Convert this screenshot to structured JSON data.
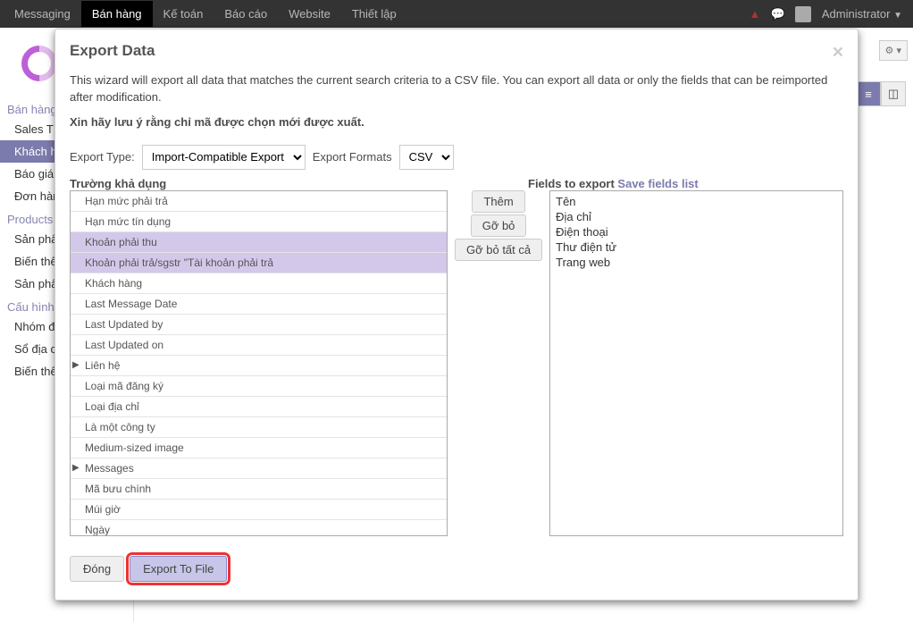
{
  "topbar": {
    "items": [
      "Messaging",
      "Bán hàng",
      "Kế toán",
      "Báo cáo",
      "Website",
      "Thiết lập"
    ],
    "active_index": 1,
    "user": "Administrator"
  },
  "sidebar": {
    "groups": [
      {
        "header": "Bán hàng",
        "items": [
          "Sales T…",
          "Khách h…",
          "Báo giá…",
          "Đơn hàng…"
        ],
        "active_index": 1
      },
      {
        "header": "Products",
        "items": [
          "Sản phẩ…",
          "Biến thể…",
          "Sản phẩ…"
        ]
      },
      {
        "header": "Cấu hình",
        "items": [
          "Nhóm đ…",
          "Sổ địa c…",
          "Biến thể…"
        ]
      }
    ]
  },
  "modal": {
    "title": "Export Data",
    "desc": "This wizard will export all data that matches the current search criteria to a CSV file. You can export all data or only the fields that can be reimported after modification.",
    "warn": "Xin hãy lưu ý rằng chỉ mã được chọn mới được xuất.",
    "export_type_label": "Export Type:",
    "export_type_value": "Import-Compatible Export",
    "export_formats_label": "Export Formats",
    "export_formats_value": "CSV",
    "left_header": "Trường khả dụng",
    "right_header": "Fields to export",
    "save_link": "Save fields list",
    "available": [
      {
        "label": "Hạn mức phải trả"
      },
      {
        "label": "Hạn mức tín dụng"
      },
      {
        "label": "Khoản phải thu",
        "selected": true
      },
      {
        "label": "Khoản phải trả/sgstr \"Tài khoản phải trả",
        "selected": true
      },
      {
        "label": "Khách hàng"
      },
      {
        "label": "Last Message Date"
      },
      {
        "label": "Last Updated by"
      },
      {
        "label": "Last Updated on"
      },
      {
        "label": "Liên hệ",
        "expandable": true
      },
      {
        "label": "Loại mã đăng ký"
      },
      {
        "label": "Loại địa chỉ"
      },
      {
        "label": "Là một công ty"
      },
      {
        "label": "Medium-sized image"
      },
      {
        "label": "Messages",
        "expandable": true
      },
      {
        "label": "Mã bưu chính"
      },
      {
        "label": "Múi giờ"
      },
      {
        "label": "Ngày"
      }
    ],
    "buttons": {
      "add": "Thêm",
      "remove": "Gỡ bỏ",
      "remove_all": "Gỡ bỏ tất cả"
    },
    "selected": [
      "Tên",
      "Địa chỉ",
      "Điện thoại",
      "Thư điện tử",
      "Trang web"
    ],
    "footer": {
      "close": "Đóng",
      "export": "Export To File"
    }
  }
}
